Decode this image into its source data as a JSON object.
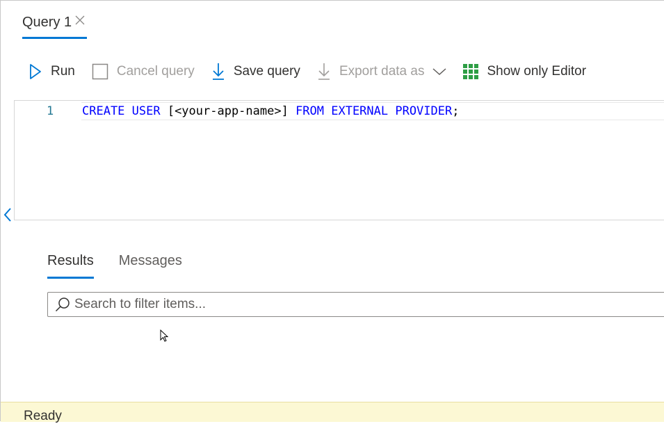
{
  "tab": {
    "label": "Query 1"
  },
  "toolbar": {
    "run_label": "Run",
    "cancel_label": "Cancel query",
    "save_label": "Save query",
    "export_label": "Export data as",
    "show_editor_label": "Show only Editor"
  },
  "editor": {
    "line_number": "1",
    "code": {
      "kw1": "CREATE USER",
      "ident": " [<your-app-name>] ",
      "kw2": "FROM EXTERNAL PROVIDER",
      "end": ";"
    }
  },
  "results": {
    "tabs": [
      "Results",
      "Messages"
    ],
    "search_placeholder": "Search to filter items..."
  },
  "status": {
    "text": "Ready"
  },
  "colors": {
    "accent": "#0078d4",
    "keyword": "#0000ff",
    "status_bg": "#fcf8d4",
    "grid_icon": "#2e9e45"
  }
}
